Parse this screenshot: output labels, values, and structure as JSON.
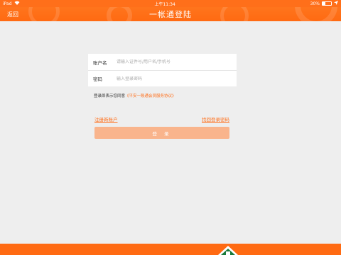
{
  "status_bar": {
    "device": "iPad",
    "time": "上午11:34",
    "battery": "30%",
    "battery_level": 0.3
  },
  "header": {
    "back_label": "返回",
    "title": "一帐通登陆"
  },
  "form": {
    "account_label": "账户名",
    "account_placeholder": "请输入证件号/用户名/手机号",
    "password_label": "密码",
    "password_placeholder": "输入登录密码"
  },
  "agreement": {
    "prefix": "登录即表示您同意",
    "link_text": "《平安一账通会员服务协议》"
  },
  "links": {
    "register": "注册新账户",
    "forgot_password": "找回登录密码"
  },
  "login_button": "登 录",
  "colors": {
    "brand_orange": "#ff6f1a",
    "button_disabled": "#f9b48c",
    "footer_green": "#1a7a3a"
  }
}
